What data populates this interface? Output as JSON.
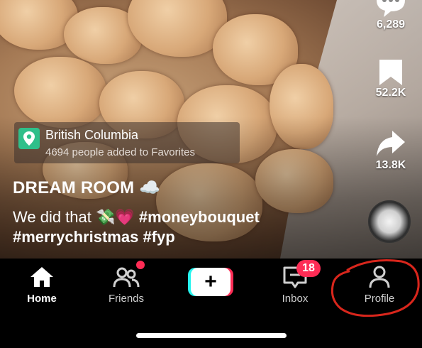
{
  "actions": {
    "comments_count": "6,289",
    "saves_count": "52.2K",
    "shares_count": "13.8K"
  },
  "location": {
    "title": "British Columbia",
    "subtitle": "4694 people added to Favorites"
  },
  "caption": {
    "title": "DREAM ROOM ☁️",
    "text_prefix": "We did that 💸💗",
    "tag1": "#moneybouquet",
    "tag2": "#merrychristmas",
    "tag3": "#fyp"
  },
  "nav": {
    "home": "Home",
    "friends": "Friends",
    "create": "+",
    "inbox": "Inbox",
    "inbox_badge": "18",
    "profile": "Profile"
  },
  "colors": {
    "accent_red": "#fe2c55",
    "accent_cyan": "#25f4ee",
    "location_pin": "#2fbf8a",
    "annotation": "#d8261c"
  }
}
